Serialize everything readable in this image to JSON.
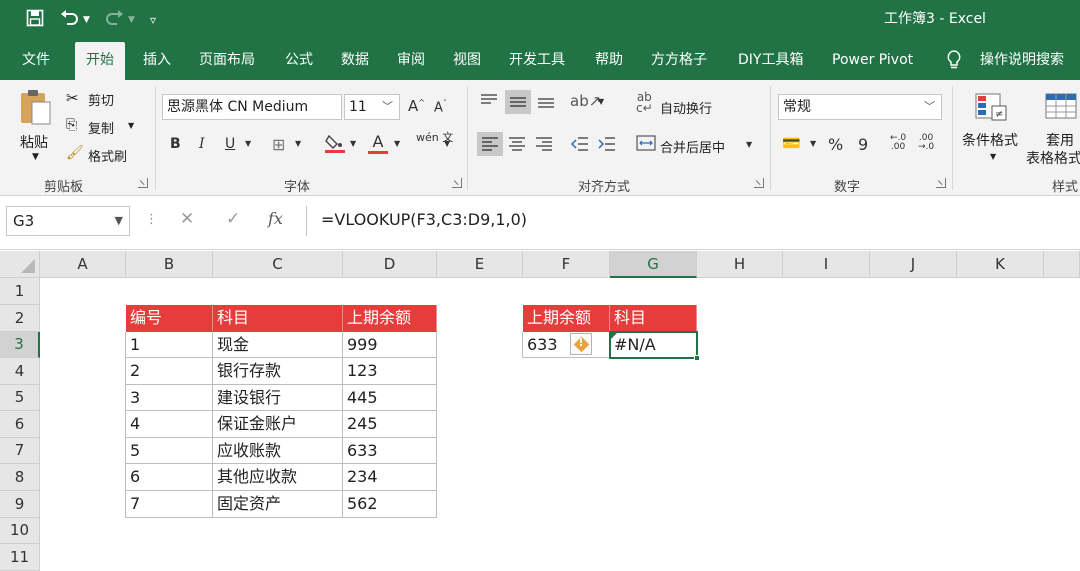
{
  "title_bar": {
    "title": "工作簿3  -  Excel"
  },
  "tabs": [
    {
      "label": "文件"
    },
    {
      "label": "开始"
    },
    {
      "label": "插入"
    },
    {
      "label": "页面布局"
    },
    {
      "label": "公式"
    },
    {
      "label": "数据"
    },
    {
      "label": "审阅"
    },
    {
      "label": "视图"
    },
    {
      "label": "开发工具"
    },
    {
      "label": "帮助"
    },
    {
      "label": "方方格子"
    },
    {
      "label": "DIY工具箱"
    },
    {
      "label": "Power Pivot"
    }
  ],
  "tell_me": "操作说明搜索",
  "ribbon": {
    "clipboard": {
      "paste": "粘贴",
      "cut": "剪切",
      "copy": "复制",
      "format_painter": "格式刷",
      "label": "剪贴板"
    },
    "font": {
      "name": "思源黑体 CN Medium",
      "size": "11",
      "label": "字体",
      "bold": "B",
      "italic": "I",
      "underline": "U",
      "font_color_letter": "A",
      "grow": "A",
      "shrink": "A",
      "phonetic": "wén 文"
    },
    "alignment": {
      "wrap": "自动换行",
      "merge": "合并后居中",
      "label": "对齐方式"
    },
    "number": {
      "format": "常规",
      "percent": "%",
      "comma": "9",
      "label": "数字"
    },
    "styles": {
      "conditional": "条件格式",
      "table_top": "套用",
      "table_bottom": "表格格式",
      "label": "样式"
    }
  },
  "formula_bar": {
    "name_box": "G3",
    "fx": "fx",
    "formula": "=VLOOKUP(F3,C3:D9,1,0)"
  },
  "columns": [
    "A",
    "B",
    "C",
    "D",
    "E",
    "F",
    "G",
    "H",
    "I",
    "J",
    "K"
  ],
  "rows": [
    "1",
    "2",
    "3",
    "4",
    "5",
    "6",
    "7",
    "8",
    "9",
    "10",
    "11"
  ],
  "table1": {
    "headers": [
      "编号",
      "科目",
      "上期余额"
    ],
    "rows": [
      [
        "1",
        "现金",
        "999"
      ],
      [
        "2",
        "银行存款",
        "123"
      ],
      [
        "3",
        "建设银行",
        "445"
      ],
      [
        "4",
        "保证金账户",
        "245"
      ],
      [
        "5",
        "应收账款",
        "633"
      ],
      [
        "6",
        "其他应收款",
        "234"
      ],
      [
        "7",
        "固定资产",
        "562"
      ]
    ]
  },
  "table2": {
    "headers": [
      "上期余额",
      "科目"
    ],
    "value": "633",
    "result": "#N/A"
  },
  "colors": {
    "excel_green": "#217346",
    "header_red": "#e53c3c",
    "warning": "#e8a33b"
  }
}
